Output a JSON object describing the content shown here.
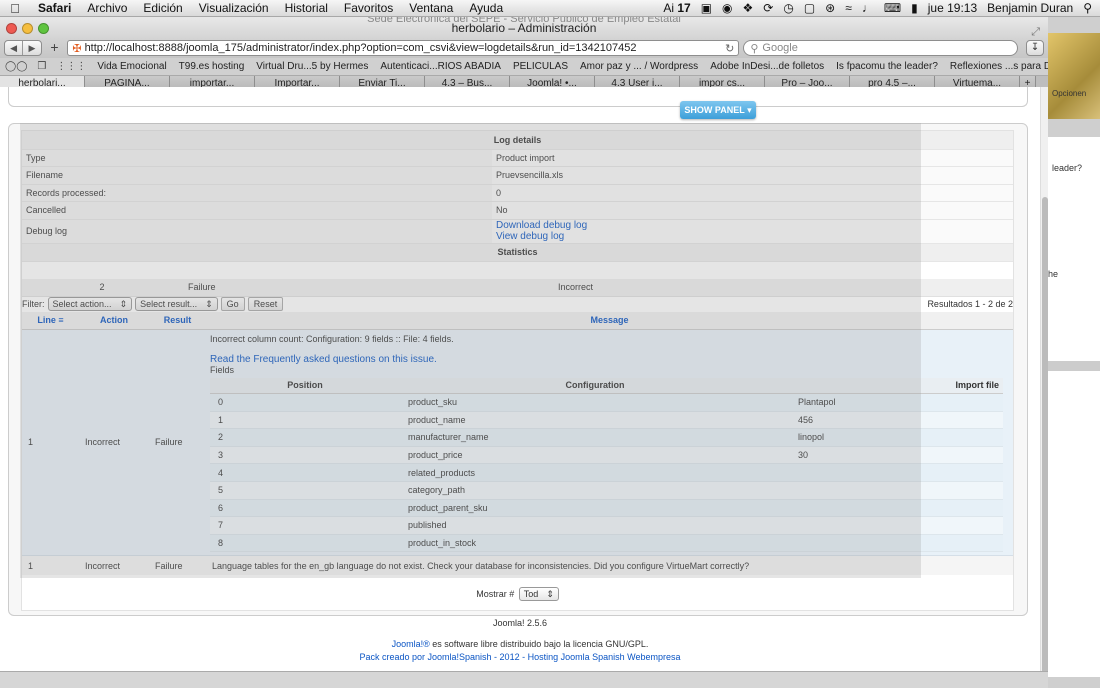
{
  "menubar": {
    "apple": "",
    "items": [
      "Safari",
      "Archivo",
      "Edición",
      "Visualización",
      "Historial",
      "Favoritos",
      "Ventana",
      "Ayuda"
    ],
    "status_badge": "17",
    "clock": "jue 19:13",
    "user": "Benjamin Duran"
  },
  "window": {
    "title": "herbolario – Administración",
    "ghost_title": "Sede Electrónica del SEPE - Servicio Público de Empleo Estatal"
  },
  "toolbar": {
    "url": "http://localhost:8888/joomla_175/administrator/index.php?option=com_csvi&view=logdetails&run_id=1342107452",
    "search_placeholder": "Google"
  },
  "bookmarks": [
    "Vida Emocional",
    "T99.es hosting",
    "Virtual Dru...5 by Hermes",
    "Autenticaci...RIOS ABADIA",
    "PELICULAS",
    "Amor paz y ... / Wordpress",
    "Adobe InDesi...de folletos",
    "Is fpacomu the leader?",
    "Reflexiones ...s para Dios"
  ],
  "tabs": [
    "herbolari...",
    "PAGINA...",
    "importar...",
    "Importar...",
    "Enviar Ti...",
    "4.3 – Bus...",
    "Joomla! •...",
    "4.3 User i...",
    "impor cs...",
    "Pro – Joo...",
    "pro 4.5 –...",
    "Virtuema...",
    "+"
  ],
  "page": {
    "show_panel": "SHOW PANEL",
    "log_details": {
      "title": "Log details",
      "rows": [
        {
          "key": "Type",
          "value": "Product import"
        },
        {
          "key": "Filename",
          "value": "Pruevsencilla.xls"
        },
        {
          "key": "Records processed:",
          "value": "0"
        },
        {
          "key": "Cancelled",
          "value": "No"
        }
      ],
      "debug_key": "Debug log",
      "download_link": "Download debug log",
      "view_link": "View debug log"
    },
    "statistics": {
      "title": "Statistics",
      "count": "2",
      "result": "Failure",
      "action": "Incorrect"
    },
    "filter": {
      "label": "Filter:",
      "action_select": "Select action...",
      "result_select": "Select result...",
      "go": "Go",
      "reset": "Reset",
      "results": "Resultados 1 - 2 de 2"
    },
    "log_table": {
      "headers": [
        "Line",
        "Action",
        "Result",
        "Message"
      ],
      "row1": {
        "line": "1",
        "action": "Incorrect",
        "result": "Failure",
        "message": "Incorrect column count: Configuration: 9 fields :: File: 4 fields.",
        "faq_link": "Read the Frequently asked questions on this issue.",
        "fields_label": "Fields",
        "fields_headers": [
          "Position",
          "Configuration",
          "Import file"
        ],
        "fields": [
          [
            "0",
            "product_sku",
            "Plantapol"
          ],
          [
            "1",
            "product_name",
            "456"
          ],
          [
            "2",
            "manufacturer_name",
            "linopol"
          ],
          [
            "3",
            "product_price",
            "30"
          ],
          [
            "4",
            "related_products",
            ""
          ],
          [
            "5",
            "category_path",
            ""
          ],
          [
            "6",
            "product_parent_sku",
            ""
          ],
          [
            "7",
            "published",
            ""
          ],
          [
            "8",
            "product_in_stock",
            ""
          ]
        ]
      },
      "row2": {
        "line": "1",
        "action": "Incorrect",
        "result": "Failure",
        "message": "Language tables for the en_gb language do not exist. Check your database for inconsistencies. Did you configure VirtueMart correctly?"
      }
    },
    "pagination": {
      "label": "Mostrar #",
      "value": "Tod"
    },
    "footer": {
      "version": "Joomla! 2.5.6",
      "joomla_link": "Joomla!®",
      "license": " es software libre distribuido bajo la licencia GNU/GPL.",
      "pack": "Pack creado por Joomla!Spanish - 2012 - Hosting Joomla Spanish Webempresa"
    }
  },
  "background_window": {
    "text1": "leader?",
    "text2": "he",
    "opc": "Opcionen"
  }
}
